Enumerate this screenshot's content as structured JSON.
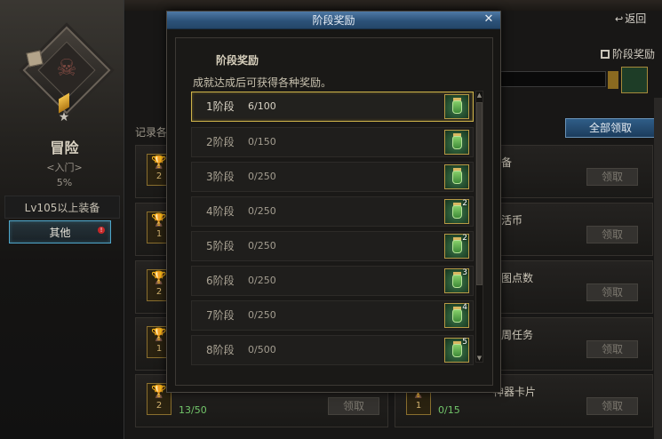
{
  "background": {
    "mode_title": "冒险",
    "mode_subtitle": "<入门>",
    "mode_percent": "5%",
    "categories": [
      {
        "label": "Lv105以上装备"
      },
      {
        "label": "其他",
        "alert": "!"
      }
    ],
    "back_label": "返回",
    "stage_reward_label": "阶段奖励",
    "record_label": "记录各",
    "claim_all_label": "全部领取",
    "claim_label": "领取",
    "cards": [
      {
        "badge": "2",
        "title": "装备",
        "progress": ""
      },
      {
        "badge": "1",
        "title": "通活币",
        "progress": ""
      },
      {
        "badge": "2",
        "title": "制图点数",
        "progress": ""
      },
      {
        "badge": "1",
        "title": "每周任务",
        "progress": ""
      },
      {
        "badge": "2",
        "title": "",
        "progress": "13/50"
      },
      {
        "badge": "1",
        "title": "",
        "progress": "0/15"
      }
    ],
    "card_titles_right": [
      "装备",
      "通活币",
      "制图点数",
      "每周任务",
      "神器卡片"
    ]
  },
  "modal": {
    "title": "阶段奖励",
    "header": "阶段奖励",
    "description": "成就达成后可获得各种奖励。",
    "stages": [
      {
        "name": "1阶段",
        "progress": "6/100",
        "reward_count": "",
        "selected": true
      },
      {
        "name": "2阶段",
        "progress": "0/150",
        "reward_count": ""
      },
      {
        "name": "3阶段",
        "progress": "0/250",
        "reward_count": ""
      },
      {
        "name": "4阶段",
        "progress": "0/250",
        "reward_count": "2"
      },
      {
        "name": "5阶段",
        "progress": "0/250",
        "reward_count": "2"
      },
      {
        "name": "6阶段",
        "progress": "0/250",
        "reward_count": "3"
      },
      {
        "name": "7阶段",
        "progress": "0/250",
        "reward_count": "4"
      },
      {
        "name": "8阶段",
        "progress": "0/500",
        "reward_count": "5"
      }
    ],
    "reward_icon": "green-potion-jar-icon"
  },
  "colors": {
    "title_bar": "#2c5279",
    "selected_border": "#cdb24a",
    "claim_all_bg": "#1c3c5c",
    "progress_text": "#72c56a"
  }
}
